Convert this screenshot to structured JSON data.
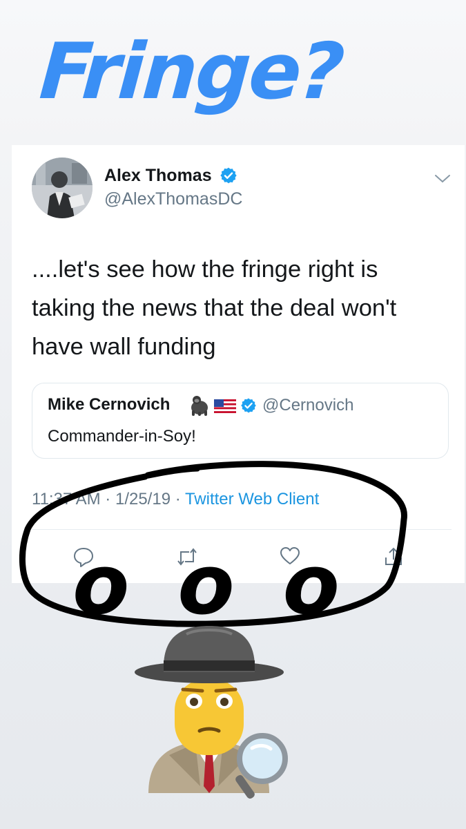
{
  "headline": "Fringe?",
  "tweet": {
    "author_name": "Alex Thomas",
    "author_handle": "@AlexThomasDC",
    "text": "....let's see how the fringe right is taking the news that the deal won't have wall funding",
    "quote": {
      "author_name": "Mike Cernovich",
      "author_handle": "@Cernovich",
      "text": "Commander-in-Soy!"
    },
    "time": "11:37 AM",
    "separator": "·",
    "date": "1/25/19",
    "client": "Twitter Web Client",
    "actions": [
      "reply-icon",
      "retweet-icon",
      "like-icon",
      "share-icon"
    ]
  },
  "annotation": {
    "letters": "o o o",
    "emoji": "sleuth-emoji"
  },
  "colors": {
    "headline": "#3a8ff5",
    "verified": "#1da1f2",
    "link": "#1b95e0",
    "secondary_text": "#657786",
    "ink": "#000000"
  }
}
